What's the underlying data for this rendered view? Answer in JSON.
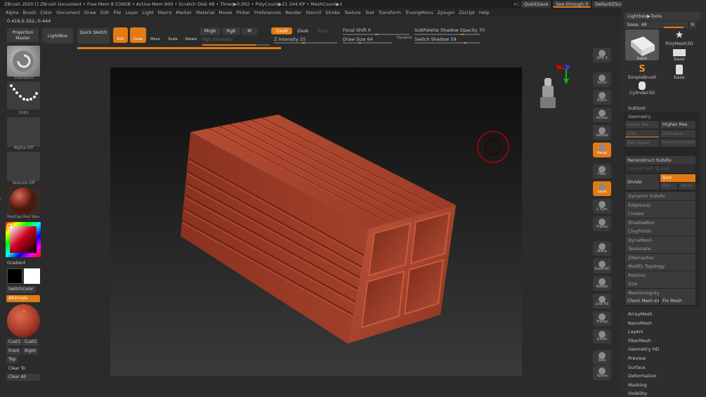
{
  "title_bar": {
    "text": "ZBrush 2020 [] ZBrush Document • Free Mem 8.539GB • Active Mem 800 • Scratch Disk 48 • Timer▶0.002 • PolyCount▶21.344 KP • MeshCount▶1",
    "ac_label": "AC",
    "quicksave_label": "QuickSave",
    "see_through_label": "See-through 0",
    "default_zscript_label": "DefaultZScript"
  },
  "menu": [
    "Alpha",
    "Brush",
    "Color",
    "Document",
    "Draw",
    "Edit",
    "File",
    "Layer",
    "Light",
    "Macro",
    "Marker",
    "Material",
    "Movie",
    "Picker",
    "Preferences",
    "Render",
    "Stencil",
    "Stroke",
    "Texture",
    "Tool",
    "Transform",
    "TruongMenu",
    "Zplugin",
    "Zscript",
    "Help"
  ],
  "coords": "0.416,0.322,-0.444",
  "toolbar": {
    "projection_master": "Projection Master",
    "lightbox": "LightBox",
    "quick_sketch": "Quick Sketch",
    "edit": "Edit",
    "draw": "Draw",
    "move": "Move",
    "scale": "Scale",
    "rotate": "Rotate",
    "mrgb": "Mrgb",
    "rgb": "Rgb",
    "m": "M",
    "rgb_intensity": "Rgb Intensity",
    "zadd": "Zadd",
    "zsub": "Zsub",
    "zcut": "Zcut",
    "z_intensity": "Z Intensity 25",
    "focal_shift": "Focal Shift 0",
    "draw_size": "Draw Size 64",
    "dynamic": "Dynamic",
    "subpalette_shadow_opacity": "SubPalette Shadow Opacity 70",
    "switch_shadow": "Switch Shadow 59"
  },
  "left_shelf": {
    "brush": "Standard",
    "stroke": "Dots",
    "alpha": "Alpha Off",
    "texture": "Texture Off",
    "material": "MatCap Red Wax",
    "gradient": "Gradient",
    "switch_color": "SwitchColor",
    "alternate": "Alternate",
    "cust1": "Cust1",
    "cust2": "Cust2",
    "front": "Front",
    "right": "Right",
    "top": "Top",
    "clear_to": "Clear To",
    "clear_all": "Clear All"
  },
  "right_shelf": [
    "SPix 3",
    "Scroll",
    "Zoom",
    "Actual",
    "AAHalf",
    "Persp",
    "Floor",
    "Local",
    "L.Sym",
    "Frame",
    "Move",
    "Zoom3D",
    "Rotate",
    "Line Fill PolyF",
    "Transp",
    "Ghost",
    "Solo",
    "Xpose"
  ],
  "palette": {
    "header": "Lightbox▶Tools",
    "base_label": "base. 48",
    "r_label": "R",
    "tools": [
      "base",
      "PolyMesh3D",
      "base",
      "SimpleBrush",
      "base",
      "Cylinder3D"
    ],
    "subtool": "Subtool",
    "geometry": "Geometry",
    "lower_res": "Lower Res",
    "higher_res": "Higher Res",
    "sdiv": "SDiv",
    "del_lower": "Del Lower",
    "del_higher": "Del Higher",
    "freeze": "Freeze SubDivision Levels",
    "reconstruct": "Reconstruct Subdiv",
    "convert_bpr": "Convert BPR To Geo",
    "divide": "Divide",
    "smt": "Smt",
    "suv": "Suv",
    "ruv": "ReUV",
    "items": [
      "Dynamic Subdiv",
      "EdgeLoop",
      "Crease",
      "ShadowBox",
      "ClayPolish",
      "DynaMesh",
      "Tessimate",
      "ZRemesher",
      "Modify Topology",
      "Position",
      "Size",
      "MeshIntegrity"
    ],
    "check_mesh": "Check Mesh Int",
    "fix_mesh": "Fix Mesh",
    "sections": [
      "ArrayMesh",
      "NanoMesh",
      "Layers",
      "FiberMesh",
      "Geometry HD",
      "Preview",
      "Surface",
      "Deformation",
      "Masking",
      "Visibility"
    ]
  },
  "colors": {
    "accent": "#e27b16",
    "brick": "#a8432c",
    "panel": "#2b2b2b"
  }
}
